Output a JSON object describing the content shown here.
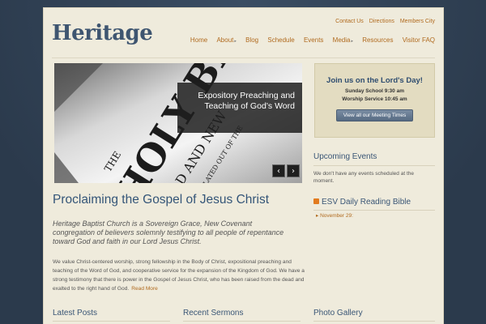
{
  "utility_nav": [
    "Contact Us",
    "Directions",
    "Members City"
  ],
  "logo": "Heritage",
  "main_nav": [
    {
      "label": "Home",
      "has_sub": false
    },
    {
      "label": "About",
      "has_sub": true
    },
    {
      "label": "Blog",
      "has_sub": false
    },
    {
      "label": "Schedule",
      "has_sub": false
    },
    {
      "label": "Events",
      "has_sub": false
    },
    {
      "label": "Media",
      "has_sub": true
    },
    {
      "label": "Resources",
      "has_sub": false
    },
    {
      "label": "Visitor FAQ",
      "has_sub": false
    }
  ],
  "slider": {
    "caption": "Expository Preaching and Teaching of God’s Word",
    "book_text": [
      "THE",
      "HOLY BIBLE",
      "OLD AND NEW",
      "TRANSLATED OUT OF THE"
    ],
    "prev_icon": "‹",
    "next_icon": "›"
  },
  "lords_day": {
    "title": "Join us on the Lord's Day!",
    "sunday_school": "Sunday School 9:30 am",
    "worship": "Worship Service 10:45 am",
    "button": "View all our Meeting Times"
  },
  "upcoming": {
    "title": "Upcoming Events",
    "text": "We don't have any events scheduled at the moment."
  },
  "esv": {
    "title": "ESV Daily Reading Bible",
    "item": "November 29:"
  },
  "main": {
    "headline": "Proclaiming the Gospel of Jesus Christ",
    "intro": "Heritage Baptist Church is a Sovereign Grace, New Covenant congregation of believers solemnly testifying to all people of repentance toward God and faith in our Lord Jesus Christ.",
    "body": "We value Christ-centered worship, strong fellowship in the Body of Christ, expositional preaching and teaching of the Word of God, and cooperative service for the expansion of the Kingdom of God. We have a strong testimony that there is power in the Gospel of Jesus Christ, who has been raised from the dead and exalted to the right hand of God.",
    "read_more": "Read More"
  },
  "bottom": {
    "latest_posts": "Latest Posts",
    "recent_sermons": "Recent Sermons",
    "photo_gallery": "Photo Gallery"
  },
  "colors": {
    "accent": "#b06a1e",
    "heading": "#345578",
    "background": "#efebdc"
  }
}
